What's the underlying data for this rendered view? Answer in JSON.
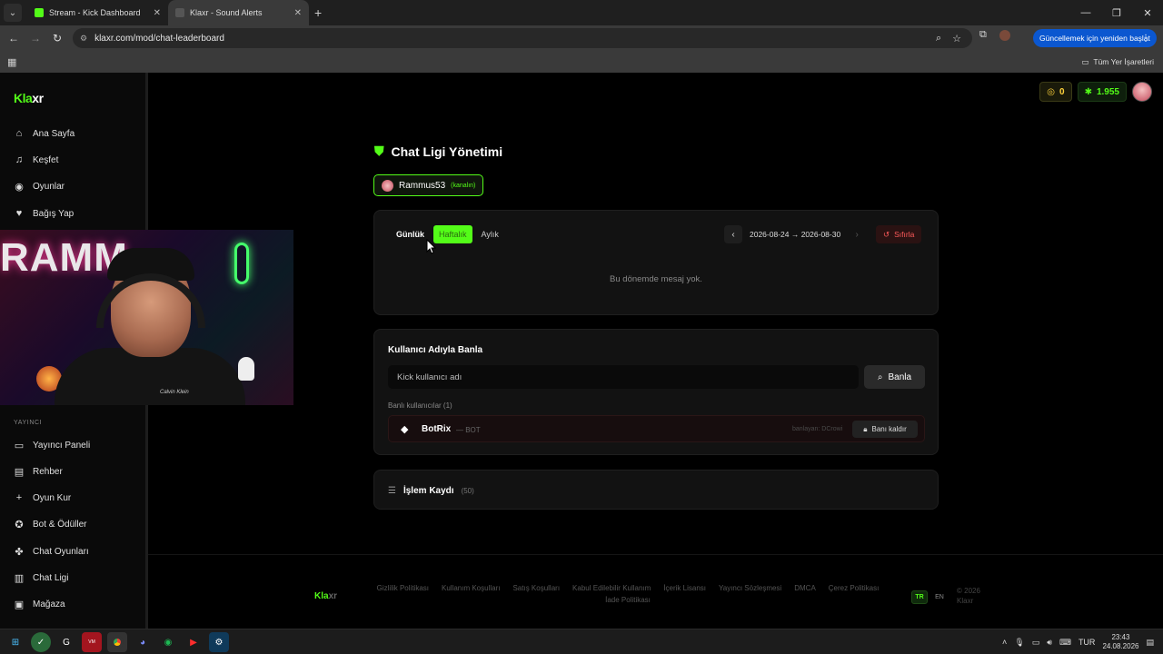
{
  "browser": {
    "tabs": [
      {
        "title": "Stream - Kick Dashboard",
        "color": "#53fc18"
      },
      {
        "title": "Klaxr - Sound Alerts",
        "color": "#444444"
      }
    ],
    "url": "klaxr.com/mod/chat-leaderboard",
    "update_label": "Güncellemek için yeniden başlat",
    "bookmarks_all": "Tüm Yer İşaretleri"
  },
  "sidebar": {
    "logo_a": "Kla",
    "logo_b": "xr",
    "items": [
      {
        "label": "Ana Sayfa",
        "icon": "home-icon"
      },
      {
        "label": "Keşfet",
        "icon": "music-icon"
      },
      {
        "label": "Oyunlar",
        "icon": "gamepad-icon"
      },
      {
        "label": "Bağış Yap",
        "icon": "heart-icon"
      }
    ],
    "section_label": "YAYINCI",
    "section_items": [
      {
        "label": "Yayıncı Paneli",
        "icon": "monitor-icon"
      },
      {
        "label": "Rehber",
        "icon": "book-icon"
      },
      {
        "label": "Oyun Kur",
        "icon": "plus-icon"
      },
      {
        "label": "Bot & Ödüller",
        "icon": "bot-icon"
      },
      {
        "label": "Chat Oyunları",
        "icon": "puzzle-icon"
      },
      {
        "label": "Chat Ligi",
        "icon": "leaderboard-icon"
      },
      {
        "label": "Mağaza",
        "icon": "store-icon"
      }
    ]
  },
  "webcam": {
    "banner_text": "RAMM",
    "shirt_text": "Calvin Klein"
  },
  "header": {
    "coins": "0",
    "points": "1.955"
  },
  "main": {
    "title": "Chat Ligi Yönetimi",
    "channel": {
      "name": "Rammus53",
      "tag": "(kanalın)"
    },
    "leaderboard": {
      "tabs": [
        {
          "label": "Günlük"
        },
        {
          "label": "Haftalık"
        },
        {
          "label": "Aylık"
        }
      ],
      "active_tab": "Haftalık",
      "date_range": "2026-08-24 → 2026-08-30",
      "reset_label": "Sıfırla",
      "empty_message": "Bu dönemde mesaj yok."
    },
    "ban": {
      "title": "Kullanıcı Adıyla Banla",
      "input_placeholder": "Kick kullanıcı adı",
      "button_label": "Banla",
      "banned_label": "Banlı kullanıcılar (1)",
      "banned": [
        {
          "name": "BotRix",
          "tag": "— BOT",
          "by": "banlayan: DCrowi",
          "action": "Banı kaldır"
        }
      ]
    },
    "log": {
      "title": "İşlem Kaydı",
      "count": "(50)"
    }
  },
  "footer": {
    "logo_a": "Kla",
    "logo_b": "xr",
    "links": [
      "Gizlilik Politikası",
      "Kullanım Koşulları",
      "Satış Koşulları",
      "Kabul Edilebilir Kullanım",
      "İçerik Lisansı",
      "Yayıncı Sözleşmesi",
      "DMCA",
      "Çerez Politikası",
      "İade Politikası"
    ],
    "lang_tr": "TR",
    "lang_en": "EN",
    "copy_a": "© 2026",
    "copy_b": "Klaxr"
  },
  "taskbar": {
    "lang": "TUR",
    "time": "23:43",
    "date": "24.08.2026"
  },
  "colors": {
    "accent": "#53fc18",
    "danger": "#ff5a5a",
    "gold": "#ffd23b"
  }
}
